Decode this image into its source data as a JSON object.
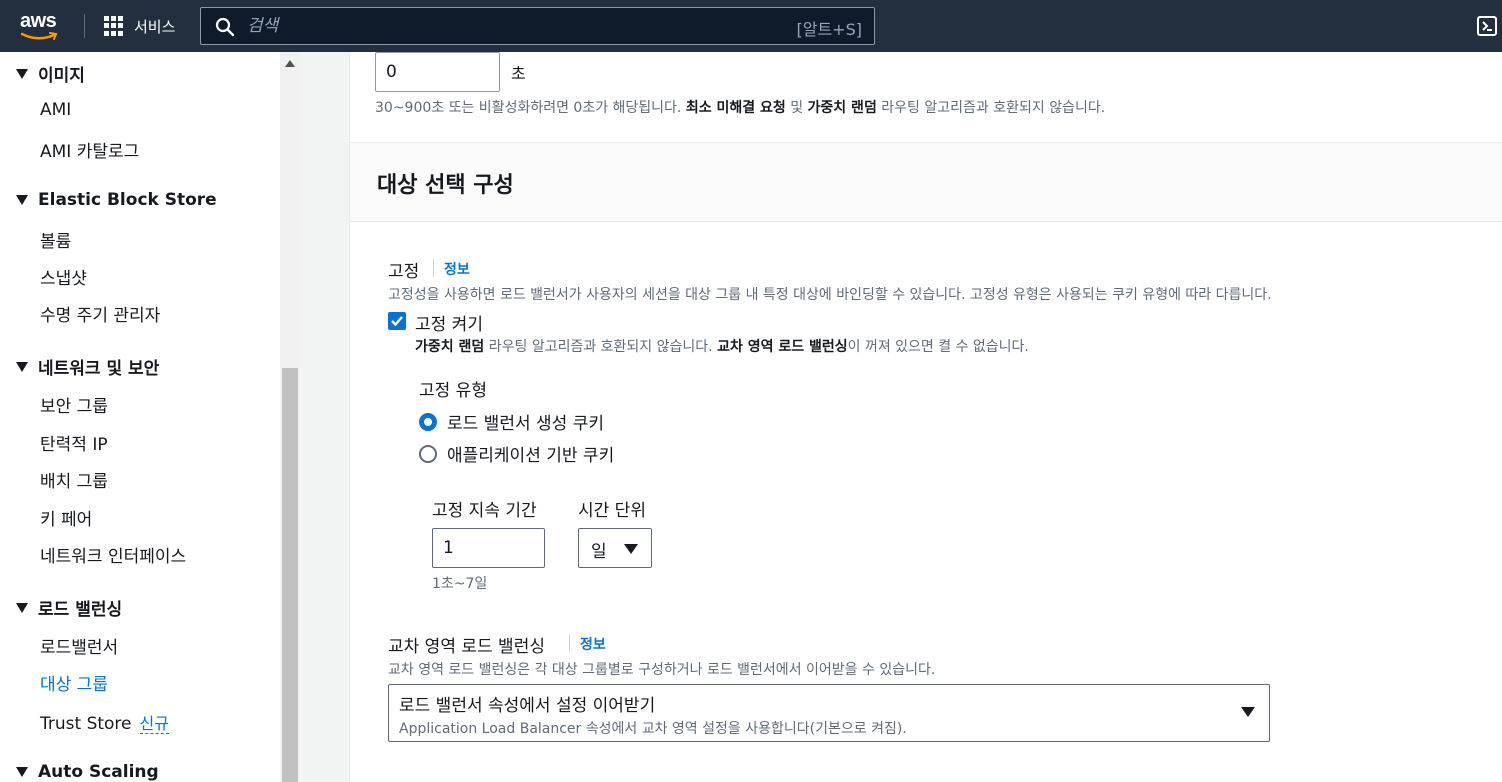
{
  "topnav": {
    "logo_text": "aws",
    "services_label": "서비스",
    "search_placeholder": "검색",
    "search_shortcut": "[알트+S]"
  },
  "sidebar": {
    "sections": [
      {
        "label": "이미지",
        "items": [
          "AMI",
          "AMI 카탈로그"
        ]
      },
      {
        "label": "Elastic Block Store",
        "items": [
          "볼륨",
          "스냅샷",
          "수명 주기 관리자"
        ]
      },
      {
        "label": "네트워크 및 보안",
        "items": [
          "보안 그룹",
          "탄력적 IP",
          "배치 그룹",
          "키 페어",
          "네트워크 인터페이스"
        ]
      },
      {
        "label": "로드 밸런싱",
        "items": [
          "로드밸런서",
          "대상 그룹",
          "Trust Store"
        ]
      },
      {
        "label": "Auto Scaling",
        "items": []
      }
    ],
    "active_item": "대상 그룹",
    "new_badge": "신규"
  },
  "main": {
    "deregistration": {
      "value": "0",
      "unit": "초",
      "hint_prefix": "30~900초 또는 비활성화하려면 0초가 해당됩니다. ",
      "hint_bold1": "최소 미해결 요청",
      "hint_mid": " 및 ",
      "hint_bold2": "가중치 랜덤",
      "hint_suffix": " 라우팅 알고리즘과 호환되지 않습니다."
    },
    "section_title": "대상 선택 구성",
    "stickiness": {
      "label": "고정",
      "info": "정보",
      "description": "고정성을 사용하면 로드 밸런서가 사용자의 세션을 대상 그룹 내 특정 대상에 바인딩할 수 있습니다. 고정성 유형은 사용되는 쿠키 유형에 따라 다릅니다.",
      "checkbox_label": "고정 켜기",
      "checked": true,
      "warn_bold1": "가중치 랜덤",
      "warn_mid": " 라우팅 알고리즘과 호환되지 않습니다. ",
      "warn_bold2": "교차 영역 로드 밸런싱",
      "warn_suffix": "이 꺼져 있으면 켤 수 없습니다.",
      "type_label": "고정 유형",
      "options": [
        "로드 밸런서 생성 쿠키",
        "애플리케이션 기반 쿠키"
      ],
      "selected_option": "로드 밸런서 생성 쿠키",
      "duration_label": "고정 지속 기간",
      "duration_value": "1",
      "duration_hint": "1초~7일",
      "time_unit_label": "시간 단위",
      "time_unit_value": "일"
    },
    "cross_zone": {
      "label": "교차 영역 로드 밸런싱",
      "info": "정보",
      "description": "교차 영역 로드 밸런싱은 각 대상 그룹별로 구성하거나 로드 밸런서에서 이어받을 수 있습니다.",
      "select_title": "로드 밸런서 속성에서 설정 이어받기",
      "select_desc": "Application Load Balancer 속성에서 교차 영역 설정을 사용합니다(기본으로 켜짐)."
    }
  },
  "colors": {
    "nav_bg": "#232f3e",
    "accent": "#0972d3",
    "smile": "#ff9900"
  }
}
